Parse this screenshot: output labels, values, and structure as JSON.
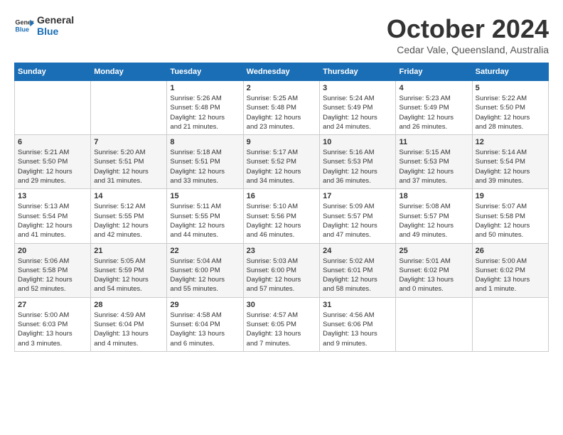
{
  "header": {
    "logo_line1": "General",
    "logo_line2": "Blue",
    "month_year": "October 2024",
    "location": "Cedar Vale, Queensland, Australia"
  },
  "days_of_week": [
    "Sunday",
    "Monday",
    "Tuesday",
    "Wednesday",
    "Thursday",
    "Friday",
    "Saturday"
  ],
  "weeks": [
    [
      {
        "day": "",
        "info": ""
      },
      {
        "day": "",
        "info": ""
      },
      {
        "day": "1",
        "info": "Sunrise: 5:26 AM\nSunset: 5:48 PM\nDaylight: 12 hours\nand 21 minutes."
      },
      {
        "day": "2",
        "info": "Sunrise: 5:25 AM\nSunset: 5:48 PM\nDaylight: 12 hours\nand 23 minutes."
      },
      {
        "day": "3",
        "info": "Sunrise: 5:24 AM\nSunset: 5:49 PM\nDaylight: 12 hours\nand 24 minutes."
      },
      {
        "day": "4",
        "info": "Sunrise: 5:23 AM\nSunset: 5:49 PM\nDaylight: 12 hours\nand 26 minutes."
      },
      {
        "day": "5",
        "info": "Sunrise: 5:22 AM\nSunset: 5:50 PM\nDaylight: 12 hours\nand 28 minutes."
      }
    ],
    [
      {
        "day": "6",
        "info": "Sunrise: 5:21 AM\nSunset: 5:50 PM\nDaylight: 12 hours\nand 29 minutes."
      },
      {
        "day": "7",
        "info": "Sunrise: 5:20 AM\nSunset: 5:51 PM\nDaylight: 12 hours\nand 31 minutes."
      },
      {
        "day": "8",
        "info": "Sunrise: 5:18 AM\nSunset: 5:51 PM\nDaylight: 12 hours\nand 33 minutes."
      },
      {
        "day": "9",
        "info": "Sunrise: 5:17 AM\nSunset: 5:52 PM\nDaylight: 12 hours\nand 34 minutes."
      },
      {
        "day": "10",
        "info": "Sunrise: 5:16 AM\nSunset: 5:53 PM\nDaylight: 12 hours\nand 36 minutes."
      },
      {
        "day": "11",
        "info": "Sunrise: 5:15 AM\nSunset: 5:53 PM\nDaylight: 12 hours\nand 37 minutes."
      },
      {
        "day": "12",
        "info": "Sunrise: 5:14 AM\nSunset: 5:54 PM\nDaylight: 12 hours\nand 39 minutes."
      }
    ],
    [
      {
        "day": "13",
        "info": "Sunrise: 5:13 AM\nSunset: 5:54 PM\nDaylight: 12 hours\nand 41 minutes."
      },
      {
        "day": "14",
        "info": "Sunrise: 5:12 AM\nSunset: 5:55 PM\nDaylight: 12 hours\nand 42 minutes."
      },
      {
        "day": "15",
        "info": "Sunrise: 5:11 AM\nSunset: 5:55 PM\nDaylight: 12 hours\nand 44 minutes."
      },
      {
        "day": "16",
        "info": "Sunrise: 5:10 AM\nSunset: 5:56 PM\nDaylight: 12 hours\nand 46 minutes."
      },
      {
        "day": "17",
        "info": "Sunrise: 5:09 AM\nSunset: 5:57 PM\nDaylight: 12 hours\nand 47 minutes."
      },
      {
        "day": "18",
        "info": "Sunrise: 5:08 AM\nSunset: 5:57 PM\nDaylight: 12 hours\nand 49 minutes."
      },
      {
        "day": "19",
        "info": "Sunrise: 5:07 AM\nSunset: 5:58 PM\nDaylight: 12 hours\nand 50 minutes."
      }
    ],
    [
      {
        "day": "20",
        "info": "Sunrise: 5:06 AM\nSunset: 5:58 PM\nDaylight: 12 hours\nand 52 minutes."
      },
      {
        "day": "21",
        "info": "Sunrise: 5:05 AM\nSunset: 5:59 PM\nDaylight: 12 hours\nand 54 minutes."
      },
      {
        "day": "22",
        "info": "Sunrise: 5:04 AM\nSunset: 6:00 PM\nDaylight: 12 hours\nand 55 minutes."
      },
      {
        "day": "23",
        "info": "Sunrise: 5:03 AM\nSunset: 6:00 PM\nDaylight: 12 hours\nand 57 minutes."
      },
      {
        "day": "24",
        "info": "Sunrise: 5:02 AM\nSunset: 6:01 PM\nDaylight: 12 hours\nand 58 minutes."
      },
      {
        "day": "25",
        "info": "Sunrise: 5:01 AM\nSunset: 6:02 PM\nDaylight: 13 hours\nand 0 minutes."
      },
      {
        "day": "26",
        "info": "Sunrise: 5:00 AM\nSunset: 6:02 PM\nDaylight: 13 hours\nand 1 minute."
      }
    ],
    [
      {
        "day": "27",
        "info": "Sunrise: 5:00 AM\nSunset: 6:03 PM\nDaylight: 13 hours\nand 3 minutes."
      },
      {
        "day": "28",
        "info": "Sunrise: 4:59 AM\nSunset: 6:04 PM\nDaylight: 13 hours\nand 4 minutes."
      },
      {
        "day": "29",
        "info": "Sunrise: 4:58 AM\nSunset: 6:04 PM\nDaylight: 13 hours\nand 6 minutes."
      },
      {
        "day": "30",
        "info": "Sunrise: 4:57 AM\nSunset: 6:05 PM\nDaylight: 13 hours\nand 7 minutes."
      },
      {
        "day": "31",
        "info": "Sunrise: 4:56 AM\nSunset: 6:06 PM\nDaylight: 13 hours\nand 9 minutes."
      },
      {
        "day": "",
        "info": ""
      },
      {
        "day": "",
        "info": ""
      }
    ]
  ]
}
